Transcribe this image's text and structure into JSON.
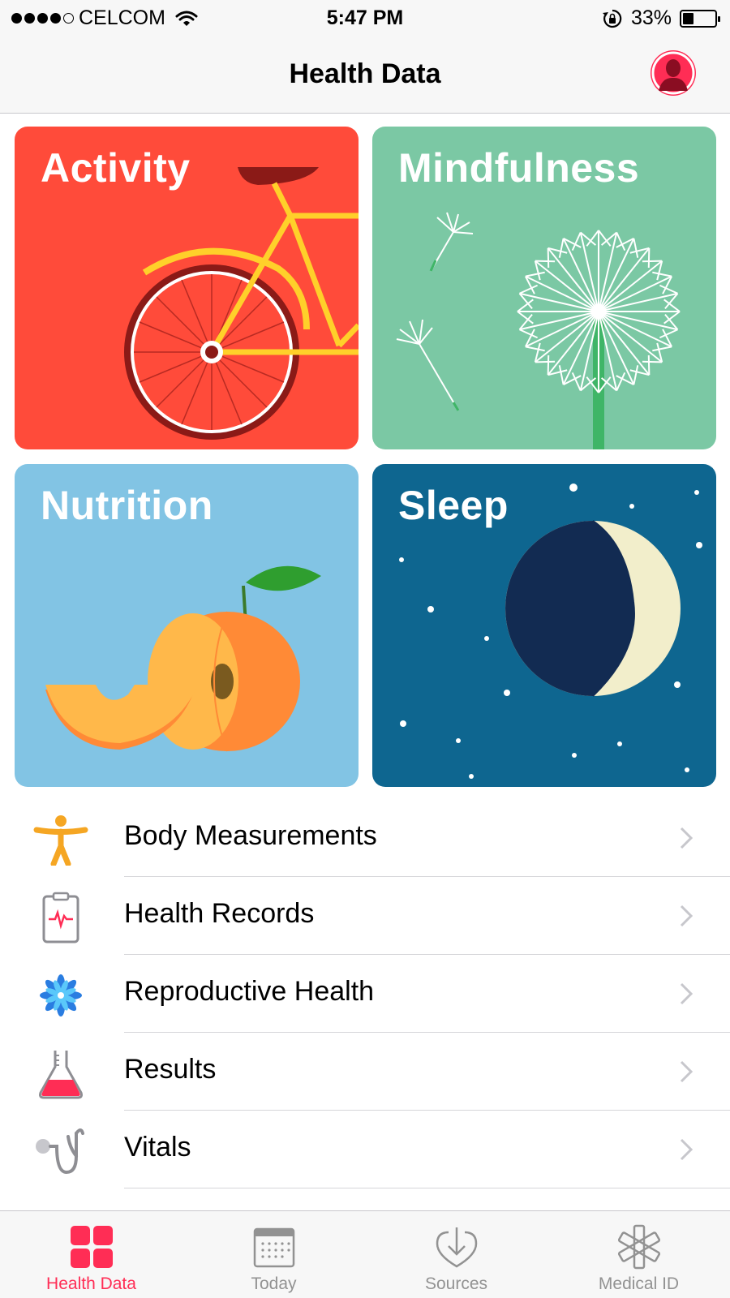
{
  "status_bar": {
    "carrier": "CELCOM",
    "time": "5:47 PM",
    "battery_percent": "33%",
    "battery_level": 0.33
  },
  "nav": {
    "title": "Health Data",
    "profile_icon": "person-icon",
    "accent": "#ff2d55"
  },
  "tiles": [
    {
      "title": "Activity",
      "color": "#ff4b3a",
      "icon": "bicycle-illustration"
    },
    {
      "title": "Mindfulness",
      "color": "#7bc8a4",
      "icon": "dandelion-illustration"
    },
    {
      "title": "Nutrition",
      "color": "#82c4e4",
      "icon": "peach-illustration"
    },
    {
      "title": "Sleep",
      "color": "#0e6690",
      "icon": "moon-illustration"
    }
  ],
  "list": [
    {
      "label": "Body Measurements",
      "icon": "body-figure-icon"
    },
    {
      "label": "Health Records",
      "icon": "clipboard-icon"
    },
    {
      "label": "Reproductive Health",
      "icon": "flower-icon"
    },
    {
      "label": "Results",
      "icon": "flask-icon"
    },
    {
      "label": "Vitals",
      "icon": "stethoscope-icon"
    }
  ],
  "tabs": [
    {
      "label": "Health Data",
      "icon": "grid-icon",
      "active": true
    },
    {
      "label": "Today",
      "icon": "calendar-icon",
      "active": false
    },
    {
      "label": "Sources",
      "icon": "heart-download-icon",
      "active": false
    },
    {
      "label": "Medical ID",
      "icon": "asterisk-icon",
      "active": false
    }
  ]
}
